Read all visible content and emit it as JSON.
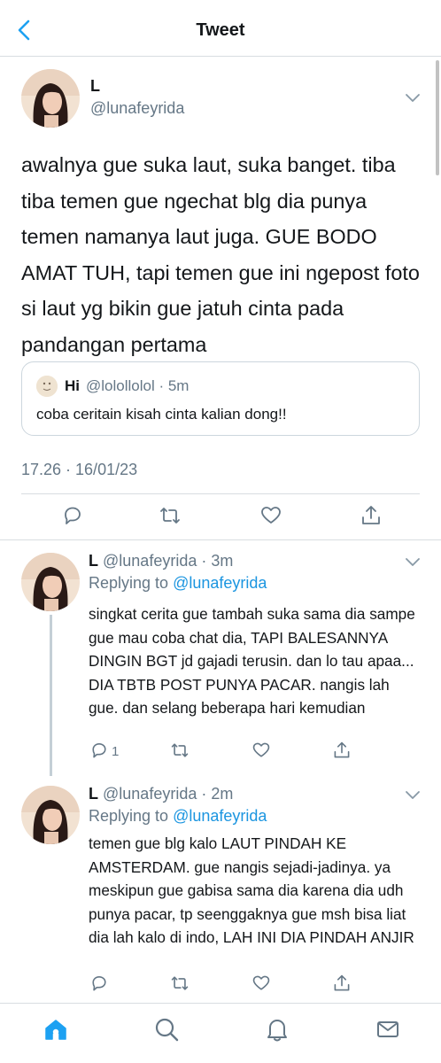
{
  "header": {
    "title": "Tweet"
  },
  "tweet": {
    "name": "L",
    "handle": "@lunafeyrida",
    "text": "awalnya gue suka laut, suka banget. tiba tiba temen gue ngechat blg dia punya temen namanya laut juga. GUE BODO AMAT TUH, tapi temen gue ini ngepost foto si laut yg bikin gue jatuh cinta pada pandangan pertama",
    "quote": {
      "name": "Hi",
      "meta": "@lolollolol · 5m",
      "text": "coba ceritain kisah cinta kalian dong!!"
    },
    "timestamp": "17.26 · 16/01/23"
  },
  "replies": [
    {
      "name": "L",
      "handle_time": "@lunafeyrida · 3m",
      "replying_prefix": "Replying to",
      "replying_to": "@lunafeyrida",
      "text": "singkat cerita gue tambah suka sama dia sampe gue mau coba chat dia, TAPI BALESANNYA DINGIN BGT jd gajadi terusin. dan lo tau apaa... DIA TBTB POST PUNYA PACAR. nangis lah gue. dan selang beberapa hari kemudian",
      "reply_count": "1"
    },
    {
      "name": "L",
      "handle_time": "@lunafeyrida · 2m",
      "replying_prefix": "Replying to",
      "replying_to": "@lunafeyrida",
      "text": "temen gue blg kalo LAUT PINDAH KE AMSTERDAM. gue nangis sejadi-jadinya. ya meskipun gue gabisa sama dia karena dia udh punya pacar, tp seenggaknya gue msh bisa liat dia lah kalo di indo, LAH INI DIA PINDAH ANJIR",
      "reply_count": ""
    }
  ],
  "icons": {
    "back": "back-chevron-icon",
    "more": "chevron-down-icon",
    "reply": "reply-bubble-icon",
    "retweet": "retweet-icon",
    "like": "heart-icon",
    "share": "share-icon",
    "home": "home-icon",
    "search": "search-icon",
    "notifications": "bell-icon",
    "messages": "envelope-icon"
  },
  "colors": {
    "accent": "#1da1f2",
    "link": "#1b95e0",
    "secondary": "#657786",
    "divider": "#d8dde1"
  }
}
